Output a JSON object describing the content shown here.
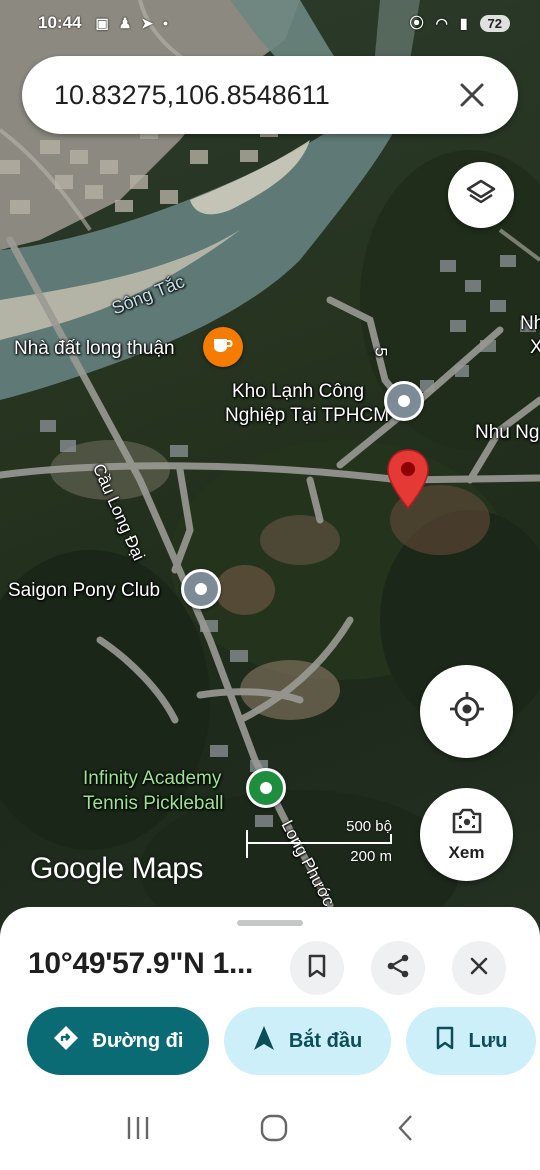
{
  "status_bar": {
    "time": "10:44",
    "battery": "72",
    "icons": [
      "picture-icon",
      "person-icon",
      "send-icon",
      "dot-icon",
      "location-icon",
      "wifi-icon",
      "signal-icon"
    ]
  },
  "search": {
    "query": "10.83275,106.8548611",
    "clear_icon": "close-icon"
  },
  "map": {
    "labels": {
      "river": "Sông Tắc",
      "poi_1": "Nhà đất long thuận",
      "poi_2_line1": "Kho Lạnh Công",
      "poi_2_line2": "Nghiệp Tại TPHCM",
      "poi_3": "Saigon Pony Club",
      "poi_4_line1": "Infinity Academy",
      "poi_4_line2": "Tennis Pickleball",
      "road_1": "Cầu Long Đại",
      "road_2": "Long Phước",
      "road_3": "5",
      "edge_1": "Nhu Ng",
      "edge_2": "Nh",
      "edge_3": "X"
    },
    "scale": {
      "imperial": "500 bộ",
      "metric": "200 m"
    },
    "logo": "Google Maps",
    "pin_color": "#e53935"
  },
  "buttons": {
    "locate_icon": "my-location-icon",
    "layers_icon": "layers-icon",
    "xem_label": "Xem"
  },
  "sheet": {
    "coord_title": "10°49'57.9\"N 1...",
    "directions_label": "Đường đi",
    "start_label": "Bắt đầu",
    "save_label": "Lưu"
  },
  "colors": {
    "primary": "#0b6b75",
    "tonal": "#cdeffa",
    "on_tonal": "#0b4e5a"
  }
}
